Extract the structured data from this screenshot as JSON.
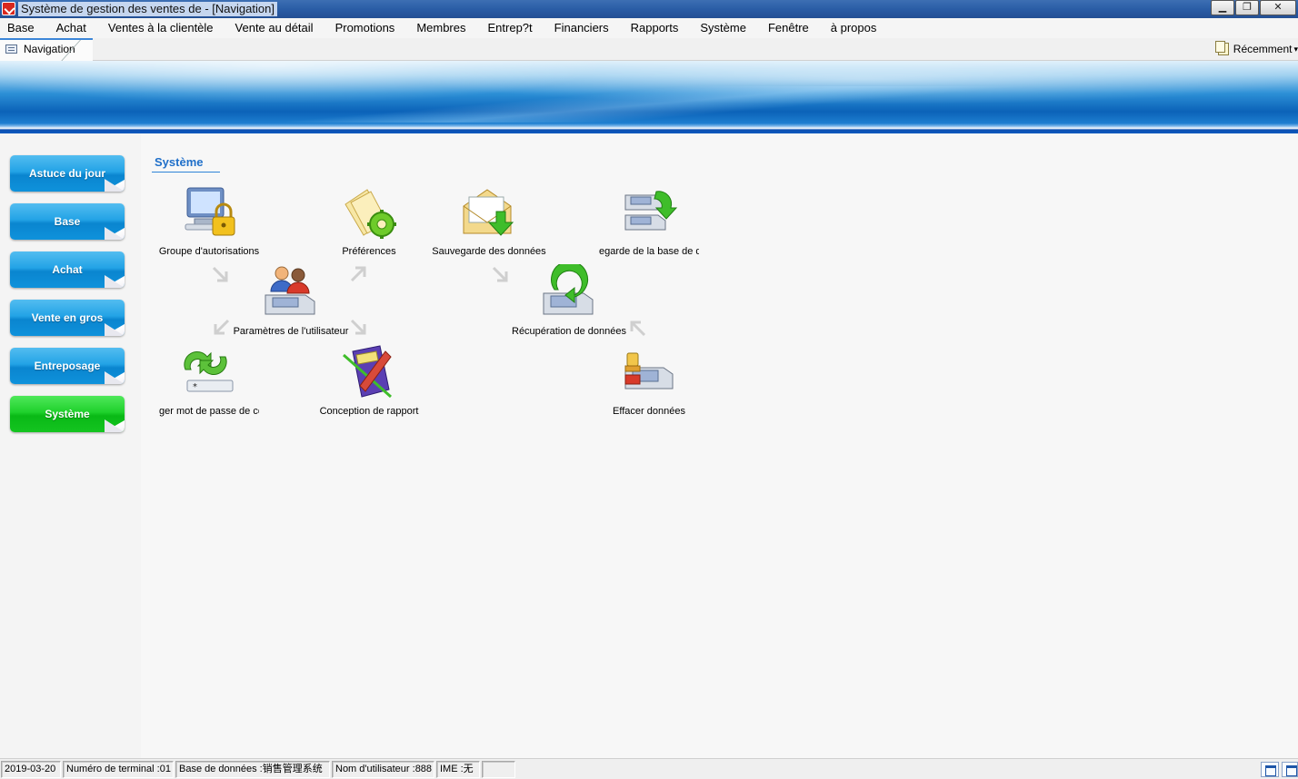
{
  "window": {
    "title": "Système de gestion des ventes de  - [Navigation]",
    "controls": [
      "minimize",
      "restore",
      "close"
    ]
  },
  "menu": {
    "items": [
      "Base",
      "Achat",
      "Ventes à la clientèle",
      "Vente au détail",
      "Promotions",
      "Membres",
      "Entrep?t",
      "Financiers",
      "Rapports",
      "Système",
      "Fenêtre",
      "à propos"
    ]
  },
  "tabs": {
    "active": "Navigation",
    "recent": "Récemment"
  },
  "leftnav": {
    "items": [
      "Astuce du jour",
      "Base",
      "Achat",
      "Vente en gros",
      "Entreposage",
      "Système"
    ],
    "active_index": 5,
    "active_color": "#14c420",
    "normal_color": "#0f92db"
  },
  "main": {
    "section_title": "Système",
    "items": [
      {
        "label": "Groupe d'autorisations",
        "icon": "computer-lock-icon"
      },
      {
        "label": "Préférences",
        "icon": "documents-gear-icon"
      },
      {
        "label": "Sauvegarde des données",
        "icon": "envelope-download-icon"
      },
      {
        "label": "egarde de la base de don",
        "icon": "drives-backup-icon"
      },
      {
        "label": "Paramètres de l'utilisateur",
        "icon": "users-drive-icon"
      },
      {
        "label": "Récupération de données",
        "icon": "drive-restore-icon"
      },
      {
        "label": "ger mot de passe de conn",
        "icon": "password-change-icon"
      },
      {
        "label": "Conception de rapport",
        "icon": "report-design-icon"
      },
      {
        "label": "Effacer données",
        "icon": "drive-clear-icon"
      }
    ]
  },
  "statusbar": {
    "date": "2019-03-20",
    "terminal": "Numéro de terminal :01",
    "database": "Base de données :销售管理系统",
    "user": "Nom d'utilisateur :888",
    "ime": "IME :无",
    "extra": ""
  }
}
